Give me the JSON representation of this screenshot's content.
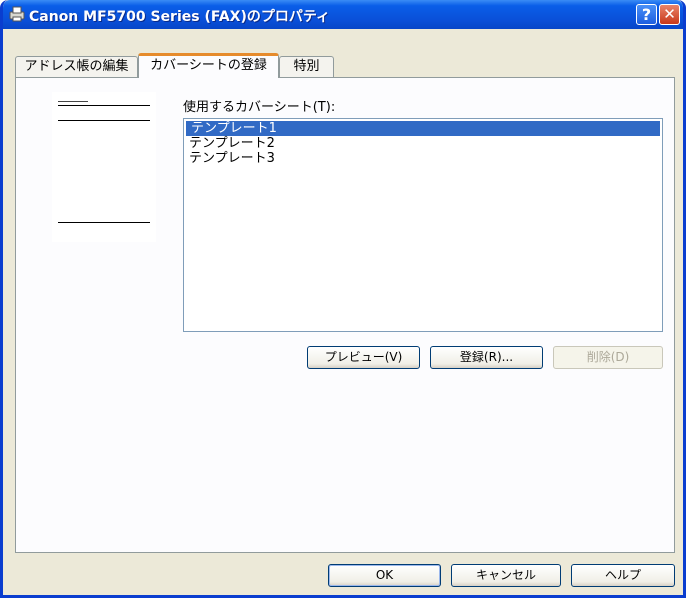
{
  "window": {
    "title": "Canon MF5700 Series (FAX)のプロパティ"
  },
  "titlebar": {
    "help_glyph": "?",
    "close_glyph": "✕"
  },
  "tabs": [
    {
      "label": "アドレス帳の編集",
      "selected": false
    },
    {
      "label": "カバーシートの登録",
      "selected": true
    },
    {
      "label": "特別",
      "selected": false
    }
  ],
  "cover": {
    "list_label": "使用するカバーシート(T):",
    "items": [
      {
        "label": "テンプレート1",
        "selected": true
      },
      {
        "label": "テンプレート2",
        "selected": false
      },
      {
        "label": "テンプレート3",
        "selected": false
      }
    ],
    "preview_label": "プレビュー(V)",
    "register_label": "登録(R)...",
    "delete_label": "削除(D)"
  },
  "footer": {
    "ok_label": "OK",
    "cancel_label": "キャンセル",
    "help_label": "ヘルプ"
  },
  "colors": {
    "titlebar": "#0a4fd8",
    "selection": "#316ac5",
    "active_tab_accent": "#e68b2c",
    "dialog_bg": "#ece9d8"
  }
}
